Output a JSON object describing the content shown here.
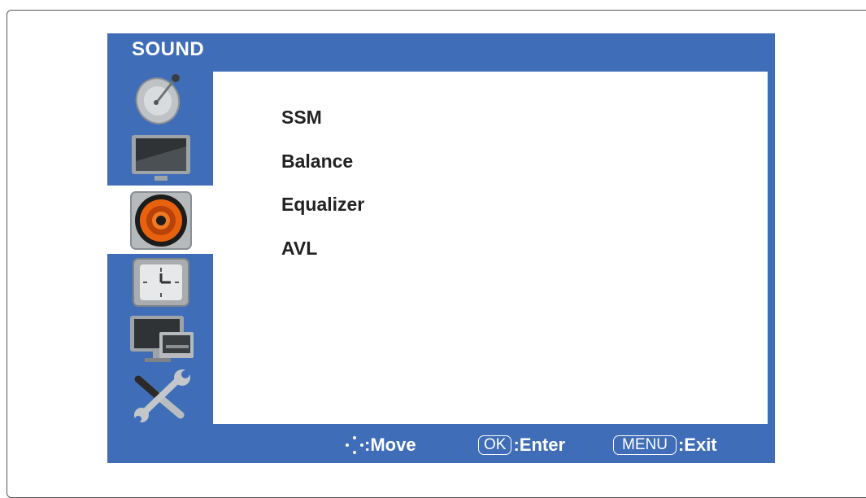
{
  "header": {
    "title": "SOUND"
  },
  "sidebar": {
    "items": [
      {
        "icon": "satellite-dish-icon"
      },
      {
        "icon": "picture-tv-icon"
      },
      {
        "icon": "speaker-icon",
        "active": true
      },
      {
        "icon": "clock-icon"
      },
      {
        "icon": "pc-monitor-icon"
      },
      {
        "icon": "tools-icon"
      }
    ]
  },
  "menu": {
    "items": [
      {
        "label": "SSM"
      },
      {
        "label": "Balance"
      },
      {
        "label": "Equalizer"
      },
      {
        "label": "AVL"
      }
    ]
  },
  "footer": {
    "move_label": ":Move",
    "ok_key": "OK",
    "enter_label": ":Enter",
    "menu_key": "MENU",
    "exit_label": ":Exit"
  },
  "colors": {
    "osd_blue": "#3f6db8",
    "panel": "#ffffff",
    "accent_orange": "#e8610c"
  }
}
